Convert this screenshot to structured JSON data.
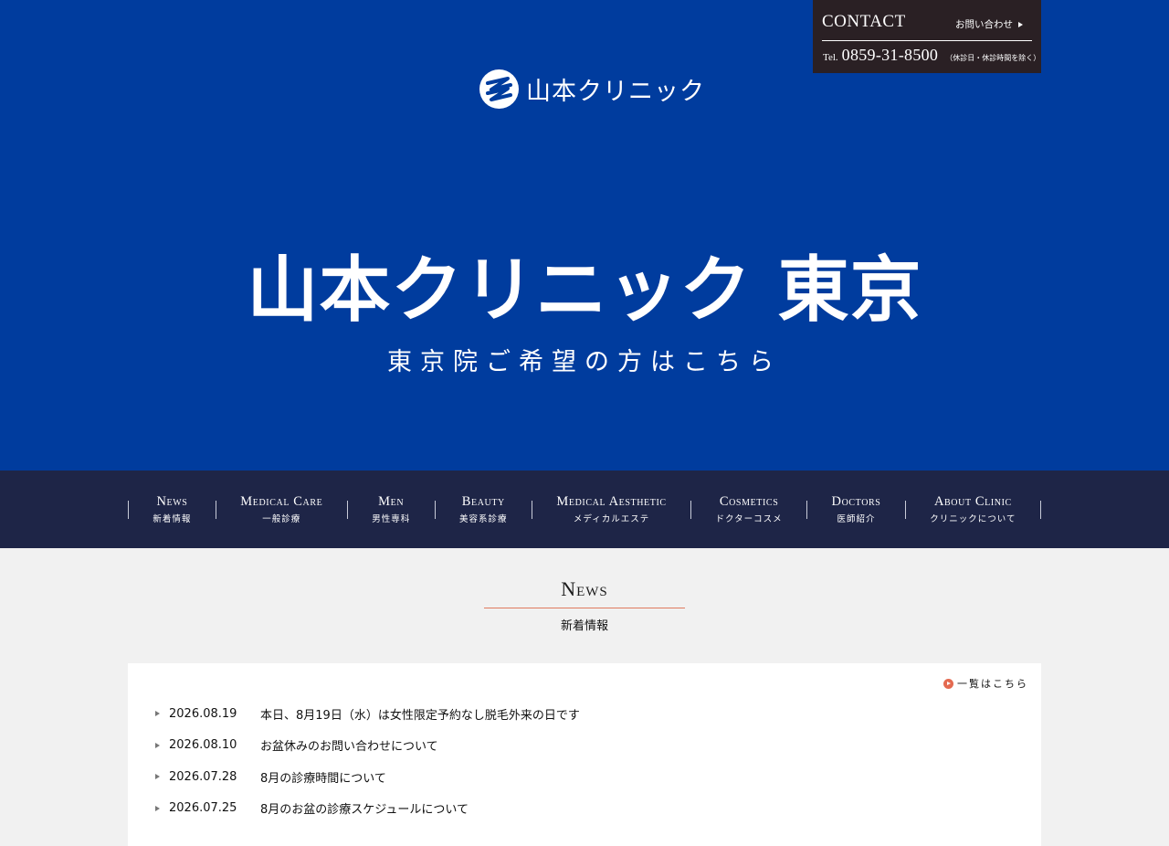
{
  "contact": {
    "title": "CONTACT",
    "link_label": "お問い合わせ",
    "tel_label": "Tel.",
    "tel_number": "0859-31-8500",
    "tel_note": "（休診日・休診時間を除く）"
  },
  "logo": {
    "text": "山本クリニック"
  },
  "hero": {
    "title": "山本クリニック 東京",
    "subtitle": "東京院ご希望の方はこちら"
  },
  "nav": {
    "items": [
      {
        "en": "News",
        "ja": "新着情報"
      },
      {
        "en": "Medical Care",
        "ja": "一般診療"
      },
      {
        "en": "Men",
        "ja": "男性専科"
      },
      {
        "en": "Beauty",
        "ja": "美容系診療"
      },
      {
        "en": "Medical Aesthetic",
        "ja": "メディカルエステ"
      },
      {
        "en": "Cosmetics",
        "ja": "ドクターコスメ"
      },
      {
        "en": "Doctors",
        "ja": "医師紹介"
      },
      {
        "en": "About Clinic",
        "ja": "クリニックについて"
      }
    ]
  },
  "news": {
    "title": "News",
    "subtitle": "新着情報",
    "more_label": "一覧はこちら",
    "items": [
      {
        "date": "2026.08.19",
        "title": "本日、8月19日（水）は女性限定予約なし脱毛外来の日です"
      },
      {
        "date": "2026.08.10",
        "title": "お盆休みのお問い合わせについて"
      },
      {
        "date": "2026.07.28",
        "title": "8月の診療時間について"
      },
      {
        "date": "2026.07.25",
        "title": "8月のお盆の診療スケジュールについて"
      }
    ]
  },
  "colors": {
    "hero_bg": "#003c9e",
    "nav_bg": "#1e2547",
    "contact_bg": "#2a2024",
    "accent": "#e07a5f",
    "page_bg": "#f1f1f1"
  }
}
